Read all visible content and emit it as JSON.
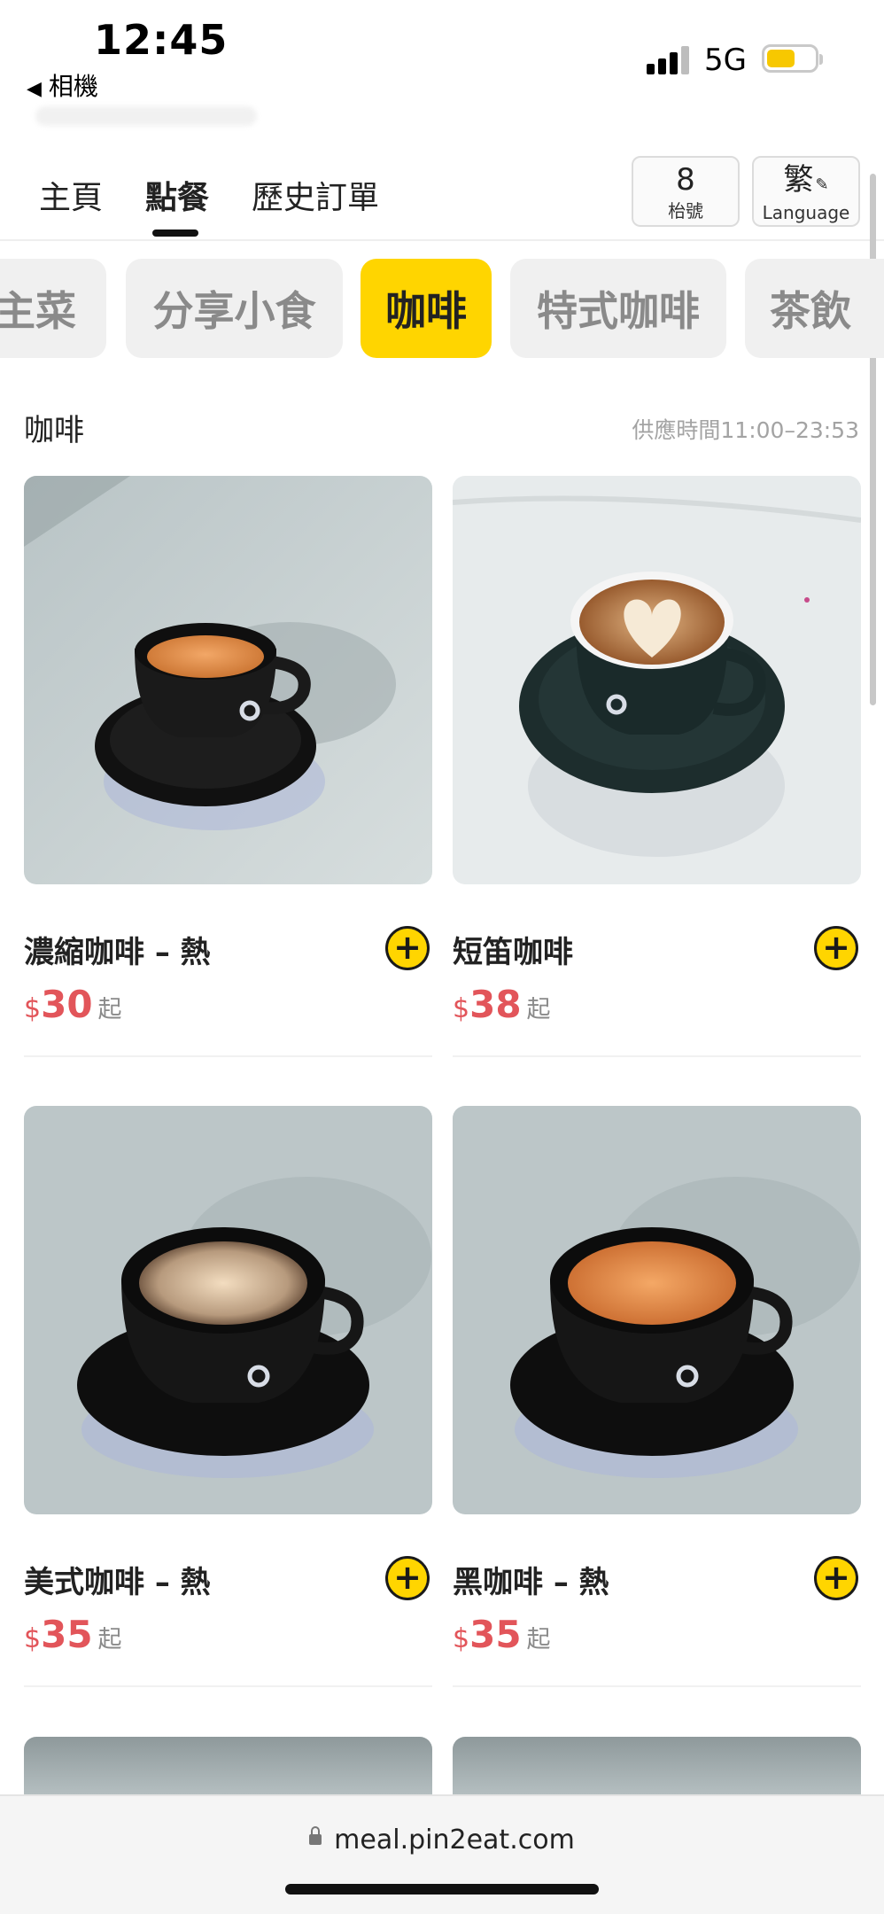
{
  "status_bar": {
    "time": "12:45",
    "back_app": "相機",
    "network": "5G",
    "battery_level": 0.6
  },
  "nav": {
    "tabs": [
      {
        "label": "主頁",
        "active": false
      },
      {
        "label": "點餐",
        "active": true
      },
      {
        "label": "歷史訂單",
        "active": false
      }
    ],
    "table": {
      "number": "8",
      "label": "枱號"
    },
    "language": {
      "current": "繁",
      "label": "Language"
    }
  },
  "categories": [
    {
      "label": "主菜",
      "active": false
    },
    {
      "label": "分享小食",
      "active": false
    },
    {
      "label": "咖啡",
      "active": true
    },
    {
      "label": "特式咖啡",
      "active": false
    },
    {
      "label": "茶飲",
      "active": false
    }
  ],
  "section": {
    "title": "咖啡",
    "hours": "供應時間11:00–23:53"
  },
  "products": [
    {
      "name": "濃縮咖啡 – 熱",
      "currency": "$",
      "price": "30",
      "suffix": "起"
    },
    {
      "name": "短笛咖啡",
      "currency": "$",
      "price": "38",
      "suffix": "起"
    },
    {
      "name": "美式咖啡 – 熱",
      "currency": "$",
      "price": "35",
      "suffix": "起"
    },
    {
      "name": "黑咖啡 – 熱",
      "currency": "$",
      "price": "35",
      "suffix": "起"
    }
  ],
  "url_bar": {
    "url": "meal.pin2eat.com"
  },
  "colors": {
    "accent": "#ffd500",
    "price": "#e2555a",
    "muted": "#a3a3a3"
  }
}
